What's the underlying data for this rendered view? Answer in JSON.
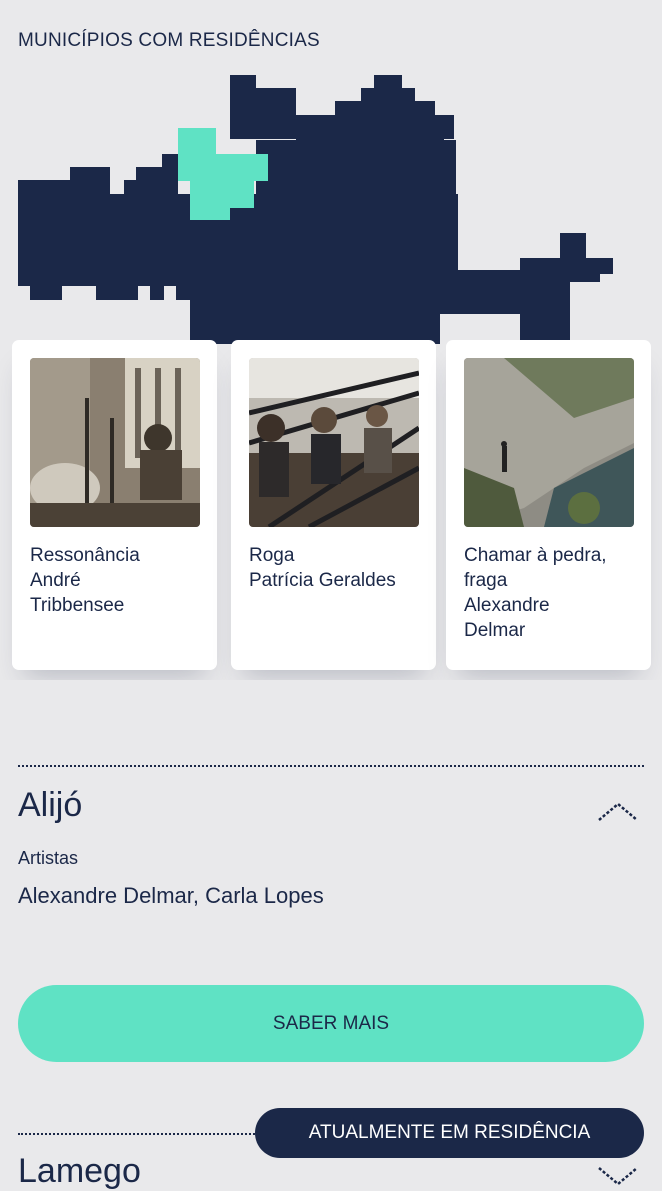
{
  "header": {
    "title": "MUNICÍPIOS COM RESIDÊNCIAS"
  },
  "colors": {
    "navy": "#1b2848",
    "accent": "#5fe2c4",
    "background": "#e9e9eb"
  },
  "cards": [
    {
      "title": "Ressonância",
      "artist_lines": [
        "André",
        "Tribbensee"
      ]
    },
    {
      "title": "Roga",
      "artist_lines": [
        "Patrícia Geraldes"
      ]
    },
    {
      "title": "Chamar à pedra,",
      "artist_lines": [
        "fraga",
        "Alexandre",
        "Delmar"
      ]
    }
  ],
  "municipality": {
    "name": "Alijó",
    "artists_label": "Artistas",
    "artists": "Alexandre Delmar, Carla Lopes",
    "more_button": "SABER MAIS"
  },
  "next_municipality": {
    "name": "Lamego"
  },
  "residency_button": "ATUALMENTE EM RESIDÊNCIA",
  "icons": {
    "collapse": "chevron-up-icon",
    "expand": "chevron-down-icon"
  }
}
